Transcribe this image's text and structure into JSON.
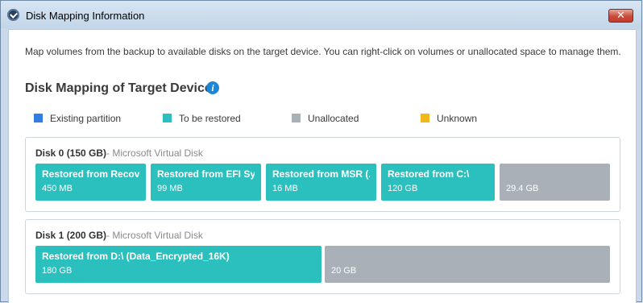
{
  "window": {
    "title": "Disk Mapping Information",
    "close_label": "✕"
  },
  "intro_text": "Map volumes from the backup to available disks on the target device. You can right-click on volumes or unallocated space to manage them.",
  "section_title": "Disk Mapping of Target Device",
  "info_icon_glyph": "i",
  "legend": [
    {
      "label": "Existing partition",
      "color": "#2f7fe0"
    },
    {
      "label": "To be restored",
      "color": "#2bbfbd"
    },
    {
      "label": "Unallocated",
      "color": "#a9b0b8"
    },
    {
      "label": "Unknown",
      "color": "#f2b719"
    }
  ],
  "disks": [
    {
      "name": "Disk 0 (150 GB)",
      "model": "- Microsoft Virtual Disk",
      "partitions": [
        {
          "label": "Restored from Recov.",
          "size": "450 MB",
          "kind": "restore"
        },
        {
          "label": "Restored from EFI Sys",
          "size": "99 MB",
          "kind": "restore"
        },
        {
          "label": "Restored from MSR (.",
          "size": "16 MB",
          "kind": "restore"
        },
        {
          "label": "Restored from C:\\",
          "size": "120 GB",
          "kind": "restore"
        },
        {
          "label": "",
          "size": "29.4 GB",
          "kind": "unalloc"
        }
      ]
    },
    {
      "name": "Disk 1 (200 GB)",
      "model": "- Microsoft Virtual Disk",
      "partitions": [
        {
          "label": "Restored from D:\\ (Data_Encrypted_16K)",
          "size": "180 GB",
          "kind": "restore"
        },
        {
          "label": "",
          "size": "20 GB",
          "kind": "unalloc"
        }
      ]
    }
  ]
}
